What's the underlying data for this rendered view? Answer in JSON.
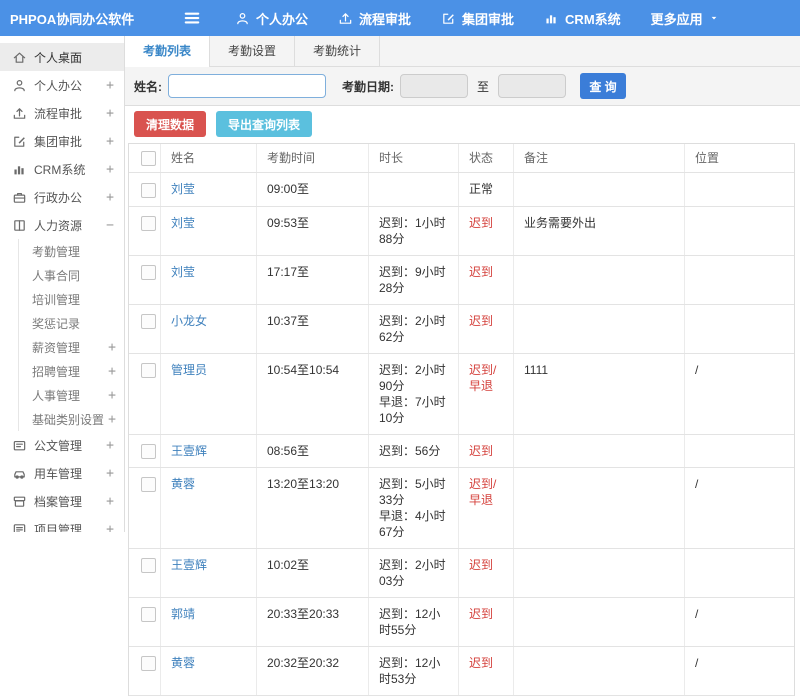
{
  "navbar": {
    "logo": "PHPOA协同办公软件",
    "items": [
      {
        "icon": "user-icon",
        "label": "个人办公",
        "caret": false
      },
      {
        "icon": "flow-icon",
        "label": "流程审批",
        "caret": false
      },
      {
        "icon": "edit-icon",
        "label": "集团审批",
        "caret": false
      },
      {
        "icon": "chart-icon",
        "label": "CRM系统",
        "caret": false
      },
      {
        "icon": null,
        "label": "更多应用",
        "caret": true
      }
    ]
  },
  "sidebar": {
    "items": [
      {
        "icon": "home-icon",
        "label": "个人桌面",
        "expander": "",
        "active": true,
        "children": []
      },
      {
        "icon": "user-icon",
        "label": "个人办公",
        "expander": "+",
        "active": false,
        "children": []
      },
      {
        "icon": "flow-icon",
        "label": "流程审批",
        "expander": "+",
        "active": false,
        "children": []
      },
      {
        "icon": "edit-icon",
        "label": "集团审批",
        "expander": "+",
        "active": false,
        "children": []
      },
      {
        "icon": "chart-icon",
        "label": "CRM系统",
        "expander": "+",
        "active": false,
        "children": []
      },
      {
        "icon": "briefcase-icon",
        "label": "行政办公",
        "expander": "+",
        "active": false,
        "children": []
      },
      {
        "icon": "book-icon",
        "label": "人力资源",
        "expander": "−",
        "active": false,
        "children": [
          {
            "label": "考勤管理",
            "expander": ""
          },
          {
            "label": "人事合同",
            "expander": ""
          },
          {
            "label": "培训管理",
            "expander": ""
          },
          {
            "label": "奖惩记录",
            "expander": ""
          },
          {
            "label": "薪资管理",
            "expander": "+"
          },
          {
            "label": "招聘管理",
            "expander": "+"
          },
          {
            "label": "人事管理",
            "expander": "+"
          },
          {
            "label": "基础类别设置",
            "expander": "+"
          }
        ]
      },
      {
        "icon": "doc-icon",
        "label": "公文管理",
        "expander": "+",
        "active": false,
        "children": []
      },
      {
        "icon": "car-icon",
        "label": "用车管理",
        "expander": "+",
        "active": false,
        "children": []
      },
      {
        "icon": "archive-icon",
        "label": "档案管理",
        "expander": "+",
        "active": false,
        "children": []
      },
      {
        "icon": "project-icon",
        "label": "项目管理",
        "expander": "+",
        "active": false,
        "children": []
      }
    ]
  },
  "tabs": [
    {
      "label": "考勤列表",
      "active": true
    },
    {
      "label": "考勤设置",
      "active": false
    },
    {
      "label": "考勤统计",
      "active": false
    }
  ],
  "search": {
    "name_label": "姓名:",
    "name_value": "",
    "date_label": "考勤日期:",
    "date_from": "",
    "to_label": "至",
    "date_to": "",
    "button_label": "查 询"
  },
  "actions": {
    "clean_label": "清理数据",
    "export_label": "导出查询列表"
  },
  "table": {
    "headers": [
      "姓名",
      "考勤时间",
      "时长",
      "状态",
      "备注",
      "位置"
    ],
    "rows": [
      {
        "name": "刘莹",
        "time": "09:00至",
        "duration": [],
        "status": "正常",
        "status_type": "normal",
        "note": "",
        "location": ""
      },
      {
        "name": "刘莹",
        "time": "09:53至",
        "duration": [
          "迟到：1小时88分"
        ],
        "status": "迟到",
        "status_type": "late",
        "note": "业务需要外出",
        "location": ""
      },
      {
        "name": "刘莹",
        "time": "17:17至",
        "duration": [
          "迟到：9小时28分"
        ],
        "status": "迟到",
        "status_type": "late",
        "note": "",
        "location": ""
      },
      {
        "name": "小龙女",
        "time": "10:37至",
        "duration": [
          "迟到：2小时62分"
        ],
        "status": "迟到",
        "status_type": "late",
        "note": "",
        "location": ""
      },
      {
        "name": "管理员",
        "time": "10:54至10:54",
        "duration": [
          "迟到：2小时90分",
          "早退：7小时10分"
        ],
        "status": "迟到/早退",
        "status_type": "late",
        "note": "1111",
        "location": "/"
      },
      {
        "name": "王壹辉",
        "time": "08:56至",
        "duration": [
          "迟到：56分"
        ],
        "status": "迟到",
        "status_type": "late",
        "note": "",
        "location": ""
      },
      {
        "name": "黄蓉",
        "time": "13:20至13:20",
        "duration": [
          "迟到：5小时33分",
          "早退：4小时67分"
        ],
        "status": "迟到/早退",
        "status_type": "late",
        "note": "",
        "location": "/"
      },
      {
        "name": "王壹辉",
        "time": "10:02至",
        "duration": [
          "迟到：2小时03分"
        ],
        "status": "迟到",
        "status_type": "late",
        "note": "",
        "location": ""
      },
      {
        "name": "郭靖",
        "time": "20:33至20:33",
        "duration": [
          "迟到：12小时55分"
        ],
        "status": "迟到",
        "status_type": "late",
        "note": "",
        "location": "/"
      },
      {
        "name": "黄蓉",
        "time": "20:32至20:32",
        "duration": [
          "迟到：12小时53分"
        ],
        "status": "迟到",
        "status_type": "late",
        "note": "",
        "location": "/"
      }
    ]
  },
  "colors": {
    "navbar_bg": "#4b91e6",
    "search_button_blue": "#3b7dd8",
    "tab_active_text": "#3a87c8",
    "link_blue": "#3f81bd",
    "danger_red": "#d9534f",
    "info_cyan": "#5bc0de",
    "status_red": "#d43f3a"
  }
}
